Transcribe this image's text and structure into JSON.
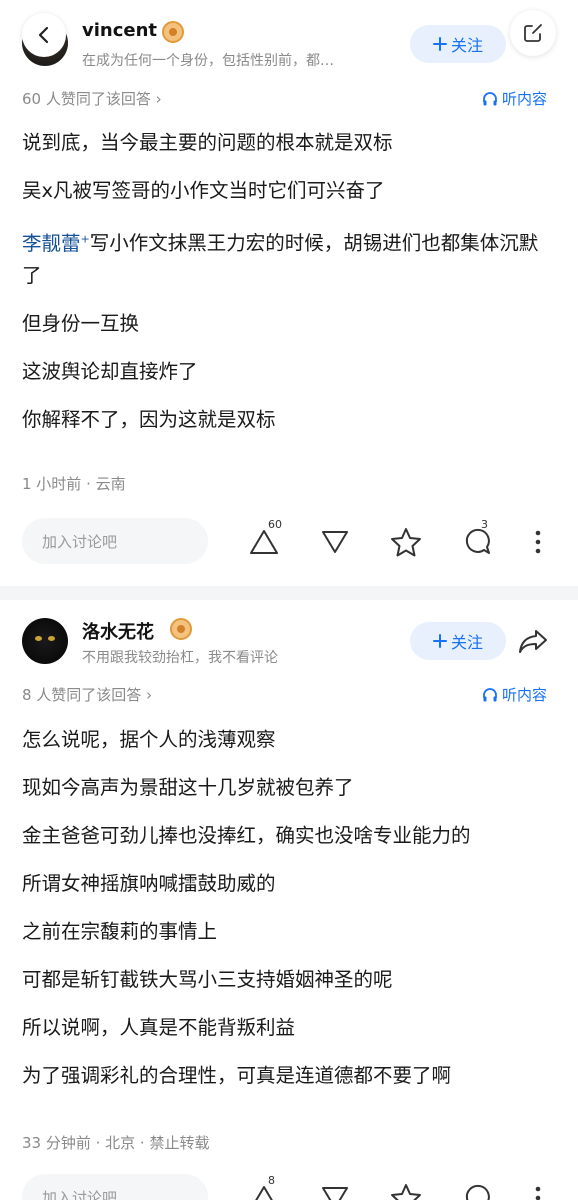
{
  "answers": [
    {
      "author": "vincent",
      "bio": "在成为任何一个身份，包括性别前，都…",
      "follow_label": "关注",
      "agree_text": "60 人赞同了该回答 ›",
      "listen_label": "听内容",
      "lines": [
        "说到底，当今最主要的问题的根本就是双标",
        "吴x凡被写签哥的小作文当时它们可兴奋了",
        "但身份一互换",
        "这波舆论却直接炸了",
        "你解释不了，因为这就是双标"
      ],
      "link_line": {
        "link_text": "李靓蕾",
        "link_mark": "+",
        "rest": "写小作文抹黑王力宏的时候，胡锡进们也都集体沉默了"
      },
      "meta": "1 小时前 · 云南",
      "comment_placeholder": "加入讨论吧",
      "upvote_count": "60",
      "comment_count": "3"
    },
    {
      "author": "洛水无花",
      "bio": "不用跟我较劲抬杠，我不看评论",
      "follow_label": "关注",
      "agree_text": "8 人赞同了该回答 ›",
      "listen_label": "听内容",
      "lines": [
        "怎么说呢，据个人的浅薄观察",
        "现如今高声为景甜这十几岁就被包养了",
        "金主爸爸可劲儿捧也没捧红，确实也没啥专业能力的",
        "所谓女神摇旗呐喊擂鼓助威的",
        "之前在宗馥莉的事情上",
        "可都是斩钉截铁大骂小三支持婚姻神圣的呢",
        "所以说啊，人真是不能背叛利益",
        "为了强调彩礼的合理性，可真是连道德都不要了啊"
      ],
      "meta": "33 分钟前 · 北京 · 禁止转载",
      "comment_placeholder": "加入讨论吧",
      "upvote_count": "8"
    }
  ],
  "colors": {
    "accent": "#1772f6",
    "link": "#175199",
    "muted": "#8a8a8a"
  }
}
